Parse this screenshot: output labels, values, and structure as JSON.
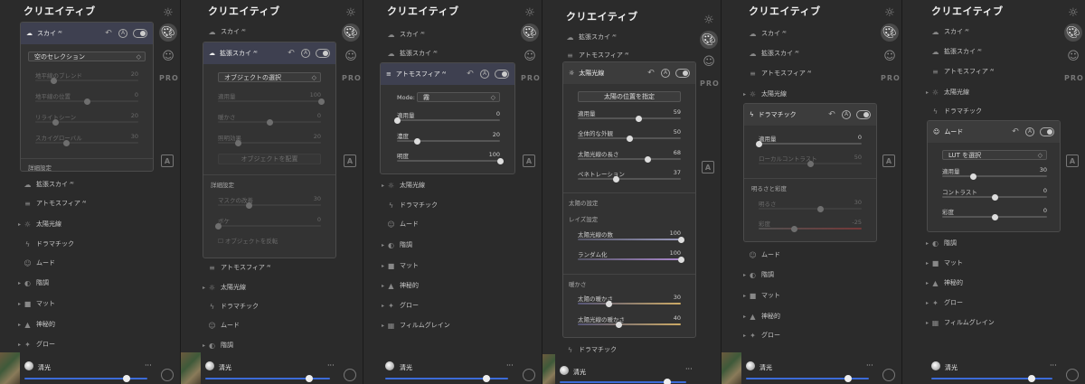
{
  "app_title": "クリエイティブ",
  "bottom_preset_name": "清光",
  "more_label": "···",
  "pro_label": "PRO",
  "a_label": "A",
  "items": {
    "sky": "スカイ ᴬᴵ",
    "sky_ext": "拡張スカイ ᴬᴵ",
    "atmosphere": "アトモスフィア ᴬᴵ",
    "sunrays": "太陽光線",
    "dramatic": "ドラマチック",
    "mood": "ムード",
    "toning": "階調",
    "matte": "マット",
    "mystic": "神秘的",
    "glow": "グロー",
    "filmgrain": "フィルムグレイン"
  },
  "p1": {
    "select": "空のセレクション",
    "s1": {
      "label": "地平線のブレンド",
      "value": "20",
      "pos": 0.18
    },
    "s2": {
      "label": "地平線の位置",
      "value": "0",
      "pos": 0.5
    },
    "s3": {
      "label": "リライトシーン",
      "value": "20",
      "pos": 0.2
    },
    "s4": {
      "label": "スカイグローバル",
      "value": "30",
      "pos": 0.3
    },
    "details": "詳細設定"
  },
  "p2": {
    "select": "オブジェクトの選択",
    "s1": {
      "label": "適用量",
      "value": "100",
      "pos": 1.0
    },
    "s2": {
      "label": "暖かさ",
      "value": "0",
      "pos": 0.5
    },
    "s3": {
      "label": "照明効果",
      "value": "20",
      "pos": 0.2
    },
    "obj_btn": "オブジェクトを配置",
    "details": "詳細設定",
    "s4": {
      "label": "マスクの改善",
      "value": "30",
      "pos": 0.3
    },
    "s5": {
      "label": "ボケ",
      "value": "0",
      "pos": 0.0
    },
    "flip": "オブジェクトを反転"
  },
  "p3": {
    "mode_label": "Mode:",
    "mode_value": "霧",
    "s1": {
      "label": "適用量",
      "value": "0",
      "pos": 0.0
    },
    "s2": {
      "label": "濃度",
      "value": "20",
      "pos": 0.2
    },
    "s3": {
      "label": "明度",
      "value": "100",
      "pos": 1.0
    }
  },
  "p4": {
    "place_btn": "太陽の位置を指定",
    "s1": {
      "label": "適用量",
      "value": "59",
      "pos": 0.59
    },
    "s2": {
      "label": "全体的な外観",
      "value": "50",
      "pos": 0.5
    },
    "s3": {
      "label": "太陽光線の長さ",
      "value": "68",
      "pos": 0.68
    },
    "s4": {
      "label": "ペネトレーション",
      "value": "37",
      "pos": 0.37
    },
    "sun_settings": "太陽の設定",
    "ray_settings": "レイズ設定",
    "s5": {
      "label": "太陽光線の数",
      "value": "100",
      "pos": 1.0
    },
    "s6": {
      "label": "ランダム化",
      "value": "100",
      "pos": 1.0
    },
    "warmth": "暖かさ",
    "s7": {
      "label": "太陽の暖かさ",
      "value": "30",
      "pos": 0.3
    },
    "s8": {
      "label": "太陽光線の暖かさ",
      "value": "40",
      "pos": 0.4
    }
  },
  "p5": {
    "s1": {
      "label": "適用量",
      "value": "0",
      "pos": 0.0
    },
    "s2": {
      "label": "ローカルコントラスト",
      "value": "50",
      "pos": 0.5
    },
    "section": "明るさと彩度",
    "s3": {
      "label": "明るさ",
      "value": "30",
      "pos": 0.6
    },
    "s4": {
      "label": "彩度",
      "value": "-25",
      "pos": 0.35
    }
  },
  "p6": {
    "select": "LUT を選択",
    "s1": {
      "label": "適用量",
      "value": "30",
      "pos": 0.3
    },
    "s2": {
      "label": "コントラスト",
      "value": "0",
      "pos": 0.5
    },
    "s3": {
      "label": "彩度",
      "value": "0",
      "pos": 0.5
    }
  },
  "colors": {
    "accent": "#3c6bd8",
    "panel": "#2b2b2b",
    "card_head": "#3e4050"
  }
}
